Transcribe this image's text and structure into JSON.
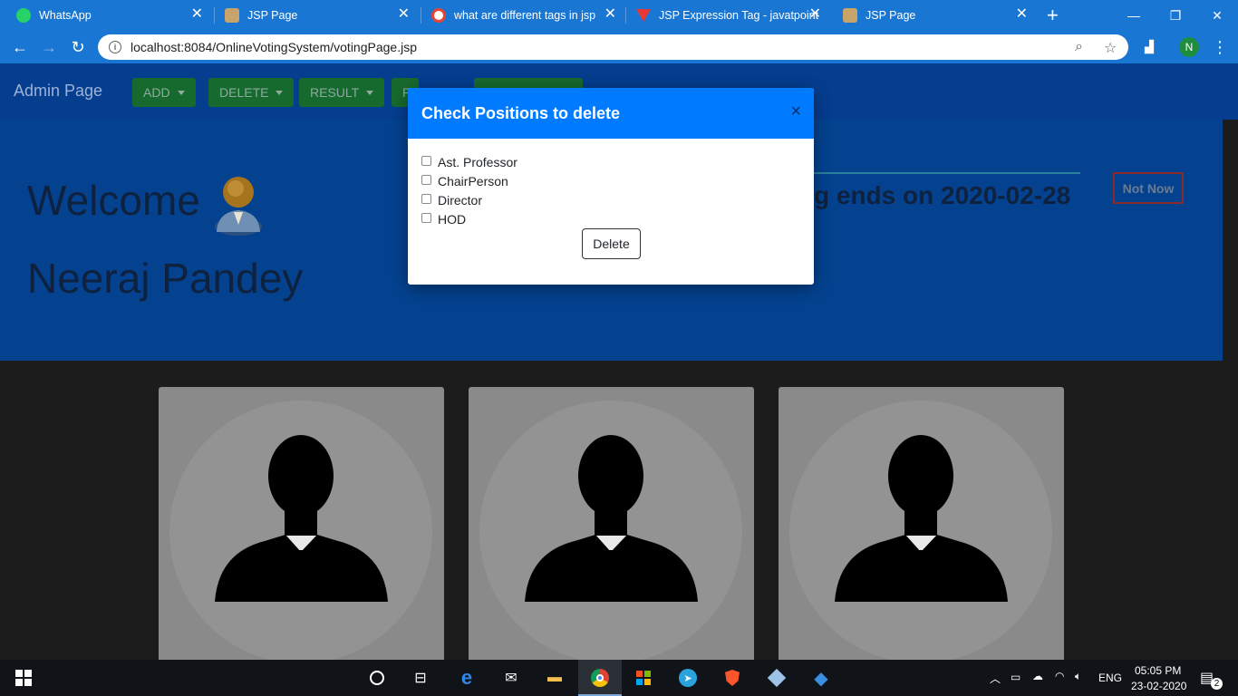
{
  "browser": {
    "tabs": [
      {
        "title": "WhatsApp",
        "icon": "whatsapp-icon",
        "color": "#25d366"
      },
      {
        "title": "JSP Page",
        "icon": "jsp-icon",
        "color": "#c9a46a"
      },
      {
        "title": "what are different tags in jsp -",
        "icon": "google-icon",
        "color": "#ffffff"
      },
      {
        "title": "JSP Expression Tag - javatpoint",
        "icon": "javatpoint-icon",
        "color": "#e53935"
      },
      {
        "title": "JSP Page",
        "icon": "jsp-icon",
        "color": "#c9a46a"
      }
    ],
    "url": "localhost:8084/OnlineVotingSystem/votingPage.jsp",
    "profile_initial": "N"
  },
  "navbar": {
    "brand": "Admin Page",
    "buttons": [
      {
        "label": "ADD",
        "dropdown": true
      },
      {
        "label": "DELETE",
        "dropdown": true
      },
      {
        "label": "RESULT",
        "dropdown": true
      },
      {
        "label": "R",
        "dropdown": false
      }
    ]
  },
  "hero": {
    "welcome": "Welcome",
    "username": "Neeraj Pandey",
    "voting_end_partial": "g ends on 2020-02-28",
    "not_now": "Not Now"
  },
  "modal": {
    "title": "Check Positions to delete",
    "close": "×",
    "options": [
      "Ast. Professor",
      "ChairPerson",
      "Director",
      "HOD"
    ],
    "delete_label": "Delete"
  },
  "taskbar": {
    "language": "ENG",
    "time": "05:05 PM",
    "date": "23-02-2020",
    "notifications": "2"
  },
  "colors": {
    "chrome_blue": "#1976d2",
    "navbar": "#053d8f",
    "button_green": "#176a2e",
    "modal_header": "#007bff"
  }
}
